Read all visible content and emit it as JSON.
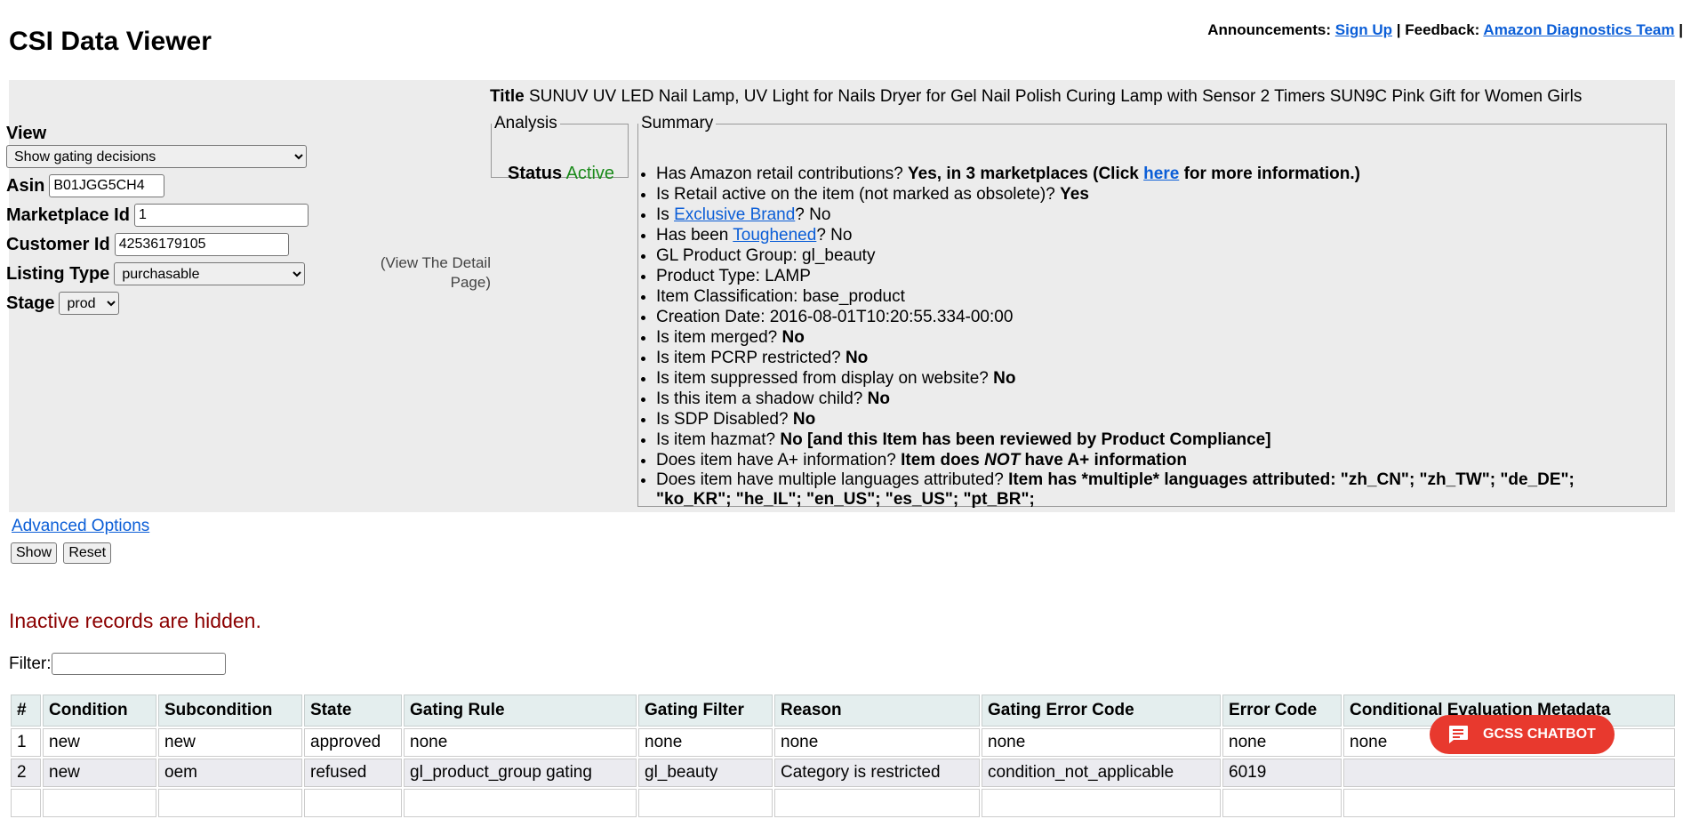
{
  "header": {
    "title": "CSI Data Viewer",
    "announcements_label": "Announcements:",
    "signup_link": "Sign Up",
    "sep1": "|",
    "feedback_label": "Feedback:",
    "feedback_link": "Amazon Diagnostics Team",
    "sep2": "|"
  },
  "form": {
    "view_label": "View",
    "view_value": "Show gating decisions",
    "asin_label": "Asin",
    "asin_value": "B01JGG5CH4",
    "marketplace_label": "Marketplace Id",
    "marketplace_value": "1",
    "customer_label": "Customer Id",
    "customer_value": "42536179105",
    "listing_label": "Listing Type",
    "listing_value": "purchasable",
    "stage_label": "Stage",
    "stage_value": "prod"
  },
  "detail_link": "(View The Detail Page)",
  "title": {
    "label": "Title",
    "value": "SUNUV UV LED Nail Lamp, UV Light for Nails Dryer for Gel Nail Polish Curing Lamp with Sensor 2 Timers SUN9C Pink Gift for Women Girls"
  },
  "analysis": {
    "legend": "Analysis",
    "status_label": "Status",
    "status_value": "Active",
    "status_color": "#1a8a1a"
  },
  "summary": {
    "legend": "Summary",
    "i1_q": "Has Amazon retail contributions?",
    "i1_a1": "Yes, in 3 marketplaces (Click",
    "i1_link": "here",
    "i1_a2": "for more information.)",
    "i2_q": "Is Retail active on the item (not marked as obsolete)?",
    "i2_a": "Yes",
    "i3_q1": "Is",
    "i3_link": "Exclusive Brand",
    "i3_q2": "? No",
    "i4_q1": "Has been",
    "i4_link": "Toughened",
    "i4_q2": "? No",
    "i5": "GL Product Group: gl_beauty",
    "i6": "Product Type: LAMP",
    "i7": "Item Classification: base_product",
    "i8": "Creation Date: 2016-08-01T10:20:55.334-00:00",
    "i9_q": "Is item merged?",
    "i9_a": "No",
    "i10_q": "Is item PCRP restricted?",
    "i10_a": "No",
    "i11_q": "Is item suppressed from display on website?",
    "i11_a": "No",
    "i12_q": "Is this item a shadow child?",
    "i12_a": "No",
    "i13_q": "Is SDP Disabled?",
    "i13_a": "No",
    "i14_q": "Is item hazmat?",
    "i14_a": "No [and this Item has been reviewed by Product Compliance]",
    "i15_q": "Does item have A+ information?",
    "i15_a1": "Item does",
    "i15_em": "NOT",
    "i15_a2": "have A+ information",
    "i16_q": "Does item have multiple languages attributed?",
    "i16_a": "Item has *multiple* languages attributed: \"zh_CN\"; \"zh_TW\"; \"de_DE\"; \"ko_KR\"; \"he_IL\"; \"en_US\"; \"es_US\"; \"pt_BR\";"
  },
  "advanced_options": "Advanced Options",
  "buttons": {
    "show": "Show",
    "reset": "Reset"
  },
  "inactive_notice": "Inactive records are hidden.",
  "filter": {
    "label": "Filter:",
    "value": ""
  },
  "table": {
    "headers": [
      "#",
      "Condition",
      "Subcondition",
      "State",
      "Gating Rule",
      "Gating Filter",
      "Reason",
      "Gating Error Code",
      "Error Code",
      "Conditional Evaluation Metadata"
    ],
    "rows": [
      [
        "1",
        "new",
        "new",
        "approved",
        "none",
        "none",
        "none",
        "none",
        "none",
        "none"
      ],
      [
        "2",
        "new",
        "oem",
        "refused",
        "gl_product_group gating",
        "gl_beauty",
        "Category is restricted",
        "condition_not_applicable",
        "6019",
        ""
      ]
    ]
  },
  "chatbot": {
    "label": "GCSS CHATBOT",
    "icon": "chat-bubble-icon",
    "color": "#e8392e"
  }
}
